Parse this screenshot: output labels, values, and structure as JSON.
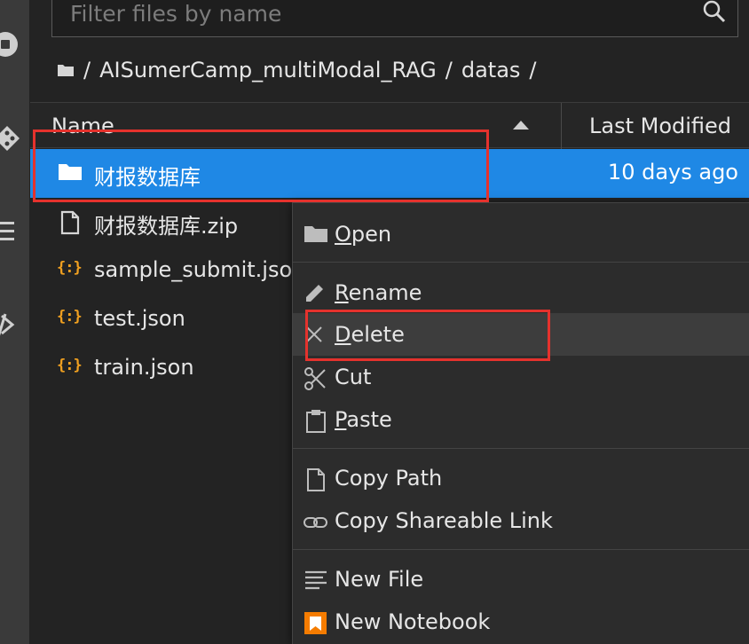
{
  "filter": {
    "placeholder": "Filter files by name"
  },
  "breadcrumb": {
    "root": "/",
    "folder1": "AISumerCamp_multiModal_RAG",
    "sep": "/",
    "folder2": "datas",
    "trail": "/"
  },
  "columns": {
    "name": "Name",
    "modified": "Last Modified"
  },
  "files": [
    {
      "name": "财报数据库",
      "type": "folder",
      "modified": "10 days ago",
      "selected": true
    },
    {
      "name": "财报数据库.zip",
      "type": "file",
      "modified": ""
    },
    {
      "name": "sample_submit.json",
      "type": "json",
      "modified": ""
    },
    {
      "name": "test.json",
      "type": "json",
      "modified": ""
    },
    {
      "name": "train.json",
      "type": "json",
      "modified": ""
    }
  ],
  "menu": {
    "open": {
      "mnemonic": "O",
      "rest": "pen"
    },
    "rename": {
      "mnemonic": "R",
      "rest": "ename"
    },
    "delete": {
      "mnemonic": "D",
      "rest": "elete"
    },
    "cut": "Cut",
    "paste": {
      "mnemonic": "P",
      "rest": "aste"
    },
    "copy_path": "Copy Path",
    "copy_link": "Copy Shareable Link",
    "new_file": "New File",
    "new_notebook": "New Notebook"
  },
  "icons": {
    "filter": "search-icon",
    "breadcrumb_root": "folder-icon",
    "sort": "sort-ascending-icon",
    "json": "{:}"
  },
  "colors": {
    "selection": "#1f88e5",
    "annotation": "#e5322d",
    "json_icon": "#f0a020",
    "notebook_icon": "#f57c00"
  }
}
